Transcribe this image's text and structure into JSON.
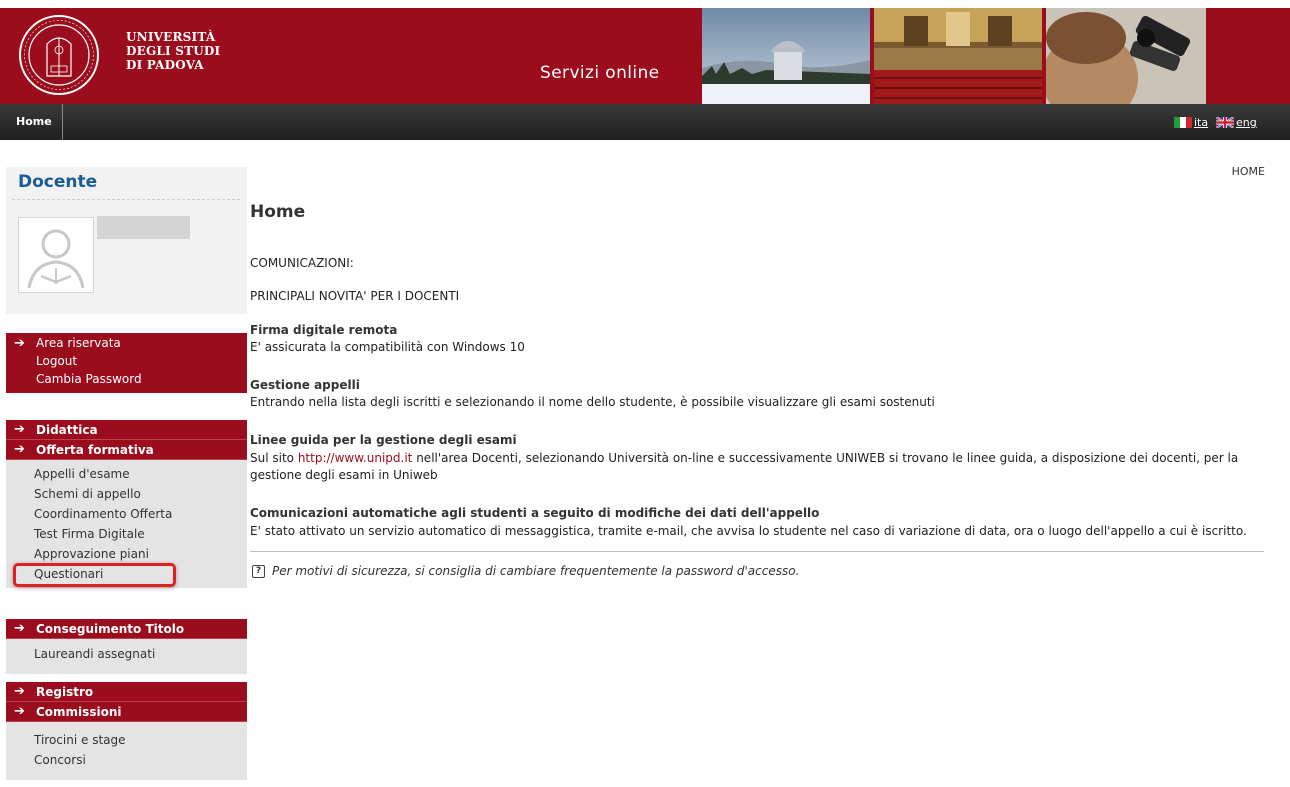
{
  "header": {
    "university_lines": [
      "UNIVERSITÀ",
      "DEGLI STUDI",
      "DI PADOVA"
    ],
    "services_title": "Servizi online"
  },
  "nav": {
    "home_label": "Home",
    "lang_ita": "ita",
    "lang_eng": "eng"
  },
  "sidebar": {
    "title": "Docente",
    "reserved": {
      "items": [
        "Area riservata",
        "Logout",
        "Cambia Password"
      ]
    },
    "menus": {
      "didattica": "Didattica",
      "offerta": "Offerta formativa",
      "offerta_items": [
        "Appelli d'esame",
        "Schemi di appello",
        "Coordinamento Offerta",
        "Test Firma Digitale",
        "Approvazione piani",
        "Questionari"
      ],
      "conseguimento": "Conseguimento Titolo",
      "conseguimento_items": [
        "Laureandi assegnati"
      ],
      "registro": "Registro",
      "commissioni": "Commissioni",
      "commissioni_items": [
        "Tirocini e stage",
        "Concorsi"
      ]
    }
  },
  "main": {
    "breadcrumb": "HOME",
    "title": "Home",
    "comunicazioni": "COMUNICAZIONI:",
    "novita": "PRINCIPALI NOVITA' PER I DOCENTI",
    "sections": [
      {
        "title": "Firma digitale remota",
        "body": "E' assicurata la compatibilità con Windows 10"
      },
      {
        "title": "Gestione appelli",
        "body": "Entrando nella lista degli iscritti e selezionando il nome dello studente, è possibile visualizzare gli esami sostenuti"
      },
      {
        "title": "Linee guida per la gestione degli esami",
        "body_before": "Sul sito ",
        "link": "http://www.unipd.it",
        "body_after": " nell'area Docenti, selezionando Università on-line e successivamente UNIWEB si trovano le linee guida, a disposizione dei docenti, per la",
        "body_line2": "gestione degli esami in Uniweb"
      },
      {
        "title": "Comunicazioni automatiche agli studenti a seguito di modifiche dei dati dell'appello",
        "body": "E' stato attivato un servizio automatico di messaggistica, tramite e-mail, che avvisa lo studente nel caso di variazione di data, ora o luogo dell'appello a cui è iscritto."
      }
    ],
    "security_note": "Per motivi di sicurezza, si consiglia di cambiare frequentemente la password d'accesso.",
    "help_glyph": "?"
  },
  "colors": {
    "brand_red": "#9b0c1d",
    "nav_dark": "#2b2b2b",
    "heading_blue": "#1a5c96",
    "highlight_red": "#e02020"
  }
}
